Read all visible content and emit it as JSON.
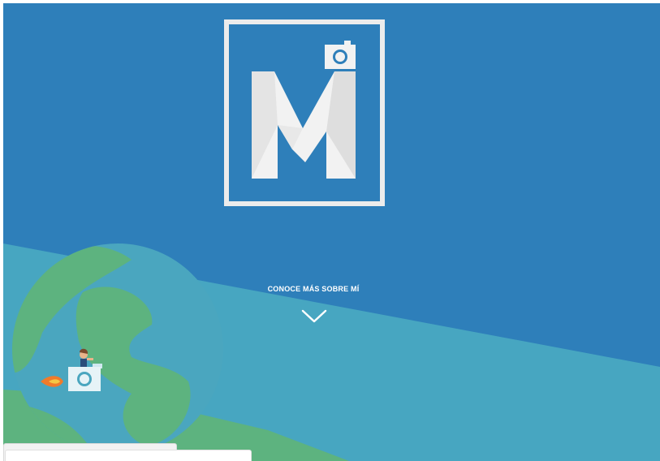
{
  "hero": {
    "cta_label": "CONOCE MÁS SOBRE MÍ"
  },
  "logo": {
    "name": "camera-m-logo"
  },
  "colors": {
    "sky_blue": "#2e7fba",
    "sea_teal": "#47a6c1",
    "land_green": "#5db37f",
    "globe_blue": "#4aa6bf",
    "white": "#ffffff"
  },
  "icons": {
    "scroll_down": "chevron-down-icon",
    "camera": "camera-icon",
    "rocket_flame": "flame-icon"
  }
}
